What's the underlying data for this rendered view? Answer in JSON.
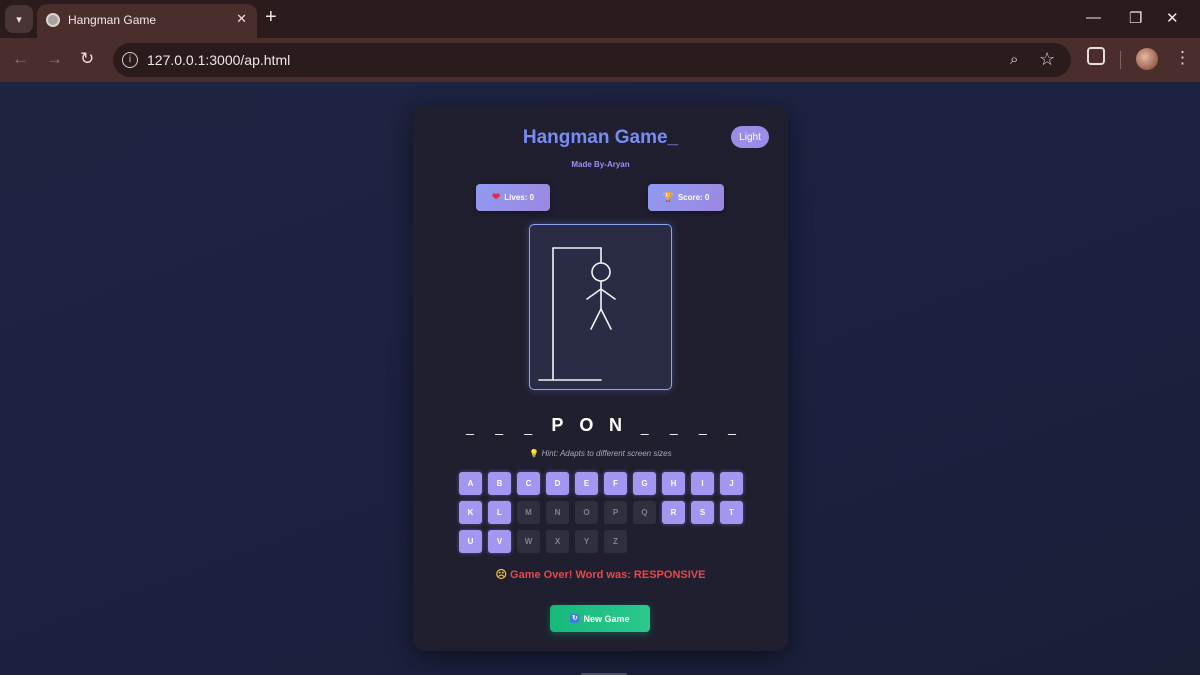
{
  "browser": {
    "tab_title": "Hangman Game",
    "url": "127.0.0.1:3000/ap.html",
    "new_tab_label": "+",
    "tab_close_label": "✕"
  },
  "game": {
    "title": "Hangman Game_",
    "theme_toggle_label": "Light",
    "made_by": "Made By-Aryan",
    "lives_label": "Lives: 0",
    "score_label": "Score: 0",
    "word_slots": [
      "_",
      "_",
      "_",
      "P",
      "O",
      "N",
      "_",
      "_",
      "_",
      "_"
    ],
    "hint_text": "Hint: Adapts to different screen sizes",
    "status_message": "Game Over! Word was: RESPONSIVE",
    "new_game_label": "New Game",
    "hangman_stage_parts_visible": 6,
    "keyboard": [
      {
        "letter": "A",
        "used": false
      },
      {
        "letter": "B",
        "used": false
      },
      {
        "letter": "C",
        "used": false
      },
      {
        "letter": "D",
        "used": false
      },
      {
        "letter": "E",
        "used": false
      },
      {
        "letter": "F",
        "used": false
      },
      {
        "letter": "G",
        "used": false
      },
      {
        "letter": "H",
        "used": false
      },
      {
        "letter": "I",
        "used": false
      },
      {
        "letter": "J",
        "used": false
      },
      {
        "letter": "K",
        "used": false
      },
      {
        "letter": "L",
        "used": false
      },
      {
        "letter": "M",
        "used": true
      },
      {
        "letter": "N",
        "used": true
      },
      {
        "letter": "O",
        "used": true
      },
      {
        "letter": "P",
        "used": true
      },
      {
        "letter": "Q",
        "used": true
      },
      {
        "letter": "R",
        "used": false
      },
      {
        "letter": "S",
        "used": false
      },
      {
        "letter": "T",
        "used": false
      },
      {
        "letter": "U",
        "used": false
      },
      {
        "letter": "V",
        "used": false
      },
      {
        "letter": "W",
        "used": true
      },
      {
        "letter": "X",
        "used": true
      },
      {
        "letter": "Y",
        "used": true
      },
      {
        "letter": "Z",
        "used": true
      }
    ],
    "colors": {
      "accent": "#7a8cf4",
      "key_active": "#a196f0",
      "key_used": "#2e2f3f",
      "game_over": "#e5484d",
      "new_game": "#16b97a"
    }
  }
}
